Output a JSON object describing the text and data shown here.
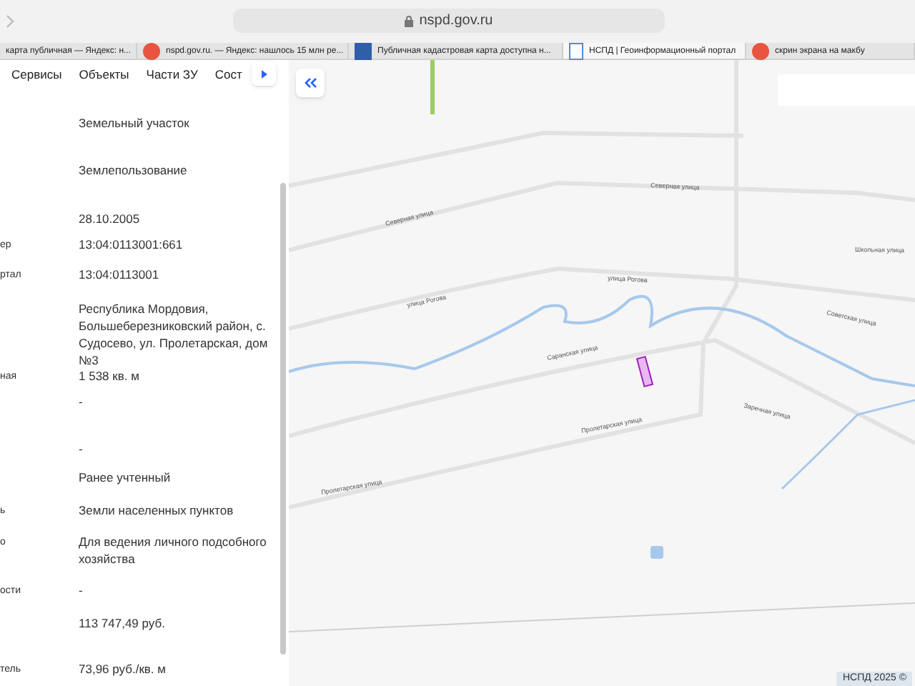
{
  "address_bar": {
    "url": "nspd.gov.ru"
  },
  "browser_tabs": [
    {
      "title": "карта публичная — Яндекс: н...",
      "selected": false
    },
    {
      "title": "nspd.gov.ru. — Яндекс: нашлось 15 млн ре...",
      "selected": false
    },
    {
      "title": "Публичная кадастровая карта доступна н...",
      "selected": false
    },
    {
      "title": "НСПД | Геоинформационный портал",
      "selected": true
    },
    {
      "title": "скрин экрана на макбу",
      "selected": false
    }
  ],
  "panel_tabs": [
    {
      "label": "Сервисы",
      "selected": false
    },
    {
      "label": "Объекты",
      "selected": false
    },
    {
      "label": "Части ЗУ",
      "selected": false
    },
    {
      "label": "Сост",
      "selected": false
    }
  ],
  "properties": [
    {
      "value": "Земельный участок"
    },
    {
      "value": "Землепользование"
    },
    {
      "value": "28.10.2005"
    },
    {
      "label": "ер",
      "value": "13:04:0113001:661"
    },
    {
      "label": "ртал",
      "value": "13:04:0113001"
    },
    {
      "value": "Республика Мордовия, Большеберезниковский район, с. Судосево, ул. Пролетарская, дом №3"
    },
    {
      "label": "ная",
      "value": "1 538 кв. м"
    },
    {
      "value": "-"
    },
    {
      "value": "-"
    },
    {
      "value": "Ранее учтенный"
    },
    {
      "label": "ь",
      "value": "Земли населенных пунктов"
    },
    {
      "label": "о",
      "value": "Для ведения личного подсобного хозяйства"
    },
    {
      "label": "ости",
      "value": "-"
    },
    {
      "value": "113 747,49 руб."
    },
    {
      "label": "тель",
      "value": "73,96 руб./кв. м"
    }
  ],
  "map": {
    "streets": [
      "Северная улица",
      "Северная улица",
      "улица Рогова",
      "улица Рогова",
      "Школьная улица",
      "Советская улица",
      "Саранская улица",
      "Пролетарская улица",
      "Пролетарская улица",
      "Заречная улица"
    ],
    "copyright": "НСПД 2025 ©"
  }
}
